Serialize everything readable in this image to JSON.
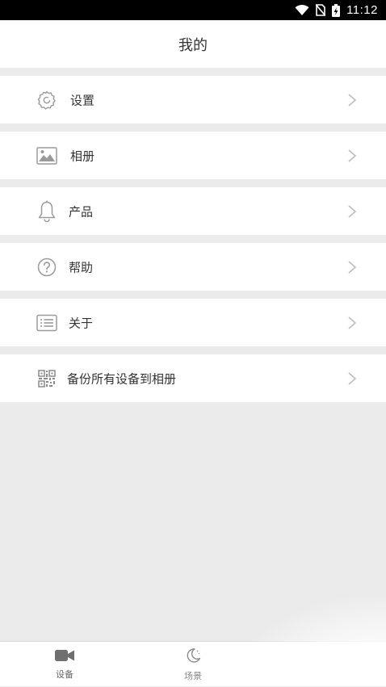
{
  "status_bar": {
    "time": "11:12"
  },
  "header": {
    "title": "我的"
  },
  "menu": {
    "items": [
      {
        "label": "设置",
        "icon": "gear-icon"
      },
      {
        "label": "相册",
        "icon": "image-icon"
      },
      {
        "label": "产品",
        "icon": "bell-icon"
      },
      {
        "label": "帮助",
        "icon": "help-circle-icon"
      },
      {
        "label": "关于",
        "icon": "about-list-icon"
      },
      {
        "label": "备份所有设备到相册",
        "icon": "qr-code-icon"
      }
    ]
  },
  "tabbar": {
    "tabs": [
      {
        "label": "设备",
        "icon": "video-camera-icon"
      },
      {
        "label": "场景",
        "icon": "moon-icon"
      }
    ]
  },
  "colors": {
    "background": "#ebebeb",
    "surface": "#ffffff",
    "text": "#333333",
    "icon": "#9a9a9a"
  }
}
